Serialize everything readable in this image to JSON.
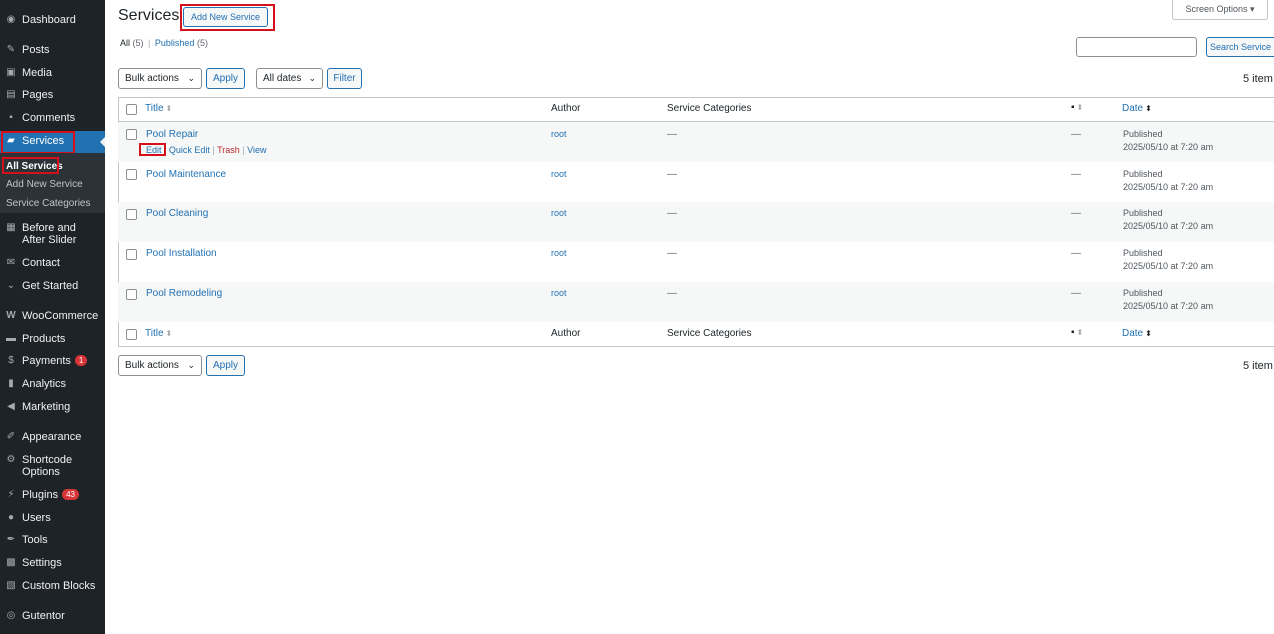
{
  "sidebar": {
    "dashboard": "Dashboard",
    "posts": "Posts",
    "media": "Media",
    "pages": "Pages",
    "comments": "Comments",
    "services": "Services",
    "all_services": "All Services",
    "add_new_service": "Add New Service",
    "service_categories": "Service Categories",
    "before_after": "Before and After Slider",
    "contact": "Contact",
    "get_started": "Get Started",
    "woocommerce": "WooCommerce",
    "products": "Products",
    "payments": "Payments",
    "payments_badge": "1",
    "analytics": "Analytics",
    "marketing": "Marketing",
    "appearance": "Appearance",
    "shortcode_options": "Shortcode Options",
    "plugins": "Plugins",
    "plugins_badge": "43",
    "users": "Users",
    "tools": "Tools",
    "settings": "Settings",
    "custom_blocks": "Custom Blocks",
    "gutentor": "Gutentor"
  },
  "header": {
    "title": "Services",
    "add_new": "Add New Service",
    "screen_options": "Screen Options"
  },
  "filters": {
    "all": "All",
    "all_count": "(5)",
    "sep": "|",
    "published": "Published",
    "published_count": "(5)"
  },
  "search": {
    "placeholder": "",
    "button": "Search Service"
  },
  "toolbar": {
    "bulk_actions": "Bulk actions",
    "apply": "Apply",
    "all_dates": "All dates",
    "filter": "Filter",
    "items": "5 item"
  },
  "table": {
    "columns": {
      "title": "Title",
      "author": "Author",
      "categories": "Service Categories",
      "date": "Date"
    },
    "row_actions": {
      "edit": "Edit",
      "quick_edit": "Quick Edit",
      "trash": "Trash",
      "view": "View"
    },
    "rows": [
      {
        "title": "Pool Repair",
        "author": "root",
        "categories": "—",
        "comments": "—",
        "status": "Published",
        "date": "2025/05/10 at 7:20 am"
      },
      {
        "title": "Pool Maintenance",
        "author": "root",
        "categories": "—",
        "comments": "—",
        "status": "Published",
        "date": "2025/05/10 at 7:20 am"
      },
      {
        "title": "Pool Cleaning",
        "author": "root",
        "categories": "—",
        "comments": "—",
        "status": "Published",
        "date": "2025/05/10 at 7:20 am"
      },
      {
        "title": "Pool Installation",
        "author": "root",
        "categories": "—",
        "comments": "—",
        "status": "Published",
        "date": "2025/05/10 at 7:20 am"
      },
      {
        "title": "Pool Remodeling",
        "author": "root",
        "categories": "—",
        "comments": "—",
        "status": "Published",
        "date": "2025/05/10 at 7:20 am"
      }
    ]
  },
  "colors": {
    "sidebar_bg": "#1d2327",
    "accent": "#2271b1",
    "highlight": "#d5101b",
    "trash": "#b32d2e"
  }
}
